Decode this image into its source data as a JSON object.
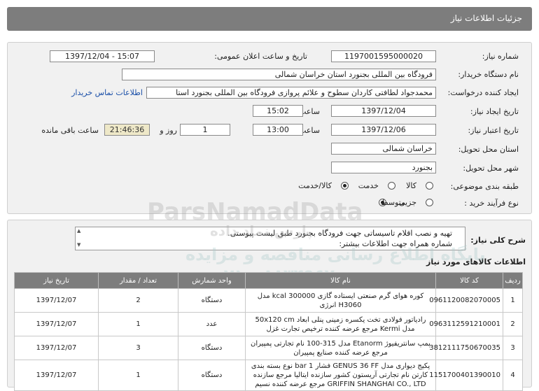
{
  "page": {
    "title": "جزئیات اطلاعات نیاز"
  },
  "form": {
    "need_number_label": "شماره نیاز:",
    "need_number": "1197001595000020",
    "announce_label": "تاریخ و ساعت اعلان عمومی:",
    "announce_value": "1397/12/04 - 15:07",
    "buyer_label": "نام دستگاه خریدار:",
    "buyer_value": "فرودگاه بین المللی بجنورد استان خراسان شمالی",
    "requester_label": "ایجاد کننده درخواست:",
    "requester_value": "محمدجواد لطافتی کاردان سطوح و علائم پروازی فرودگاه بین المللی بجنورد استا",
    "contact_link": "اطلاعات تماس خریدار",
    "created_label": "تاریخ ایجاد نیاز:",
    "created_date": "1397/12/04",
    "time_label": "ساعت",
    "created_time": "15:02",
    "validity_label": "تاریخ اعتبار نیاز:",
    "validity_date": "1397/12/06",
    "validity_time": "13:00",
    "days_value": "1",
    "day_and_label": "روز و",
    "remaining_time": "21:46:36",
    "remaining_label": "ساعت باقی مانده",
    "province_label": "استان محل تحویل:",
    "province_value": "خراسان شمالی",
    "city_label": "شهر محل تحویل:",
    "city_value": "بجنورد",
    "category_label": "طبقه بندی موضوعی:",
    "category_options": [
      "کالا",
      "خدمت",
      "کالا/خدمت"
    ],
    "category_selected": 2,
    "process_label": "نوع فرآیند خرید :",
    "process_options": [
      "جزیی",
      "متوسط"
    ],
    "process_selected": 1
  },
  "description": {
    "label": "شرح کلی نیاز:",
    "line1": "تهیه و نصب اقلام تاسیساتی جهت فرودگاه بجنورد طبق لیست پیوستی.",
    "line2": "شماره همراه جهت اطلاعات بیشتر:"
  },
  "goods": {
    "title": "اطلاعات کالاهای مورد نیاز",
    "headers": [
      "ردیف",
      "کد کالا",
      "نام کالا",
      "واحد شمارش",
      "تعداد / مقدار",
      "تاریخ نیاز"
    ],
    "rows": [
      {
        "row": "1",
        "code": "0961120082070005",
        "name1": "کوره هوای گرم صنعتی ایستاده گازی 300000 kcal مدل",
        "name2": "H3060 انرژی",
        "unit": "دستگاه",
        "qty": "2",
        "date": "1397/12/07"
      },
      {
        "row": "2",
        "code": "0963112591210001",
        "name1": "رادیاتور فولادی تخت یکسره زمینی پنلی ابعاد 50x120 cm",
        "name2": "مدل Kermi مرجع عرضه کننده ترخیص تجارت غزل",
        "unit": "عدد",
        "qty": "1",
        "date": "1397/12/07"
      },
      {
        "row": "3",
        "code": "3812111750670035",
        "name1": "پمپ سانتریفیوژ Etanorm مدل 315-100 نام تجارتی پمپیران",
        "name2": "مرجع عرضه کننده صنایع پمپیران",
        "unit": "دستگاه",
        "qty": "3",
        "date": "1397/12/07"
      },
      {
        "row": "4",
        "code": "1151700401390010",
        "name1": "پکیج دیواری مدل GENUS 36 FF فشار 1 bar نوع بسته بندی",
        "name2": "کارتن نام تجارتی آریستون کشور سازنده ایتالیا مرجع سازنده",
        "name3": "GRIFFIN SHANGHAI CO., LTD مرجع عرضه کننده نسیم",
        "unit": "دستگاه",
        "qty": "1",
        "date": "1397/12/07"
      }
    ]
  },
  "watermark": {
    "brand": "ParsNamadData",
    "fa1": "پارس نماد داده",
    "fa2": "پایگاه اطلاع رسانی مناقصه و مزایده",
    "phone": "۰۲۱ - ۸۸۳۴۹۶۷۰"
  }
}
